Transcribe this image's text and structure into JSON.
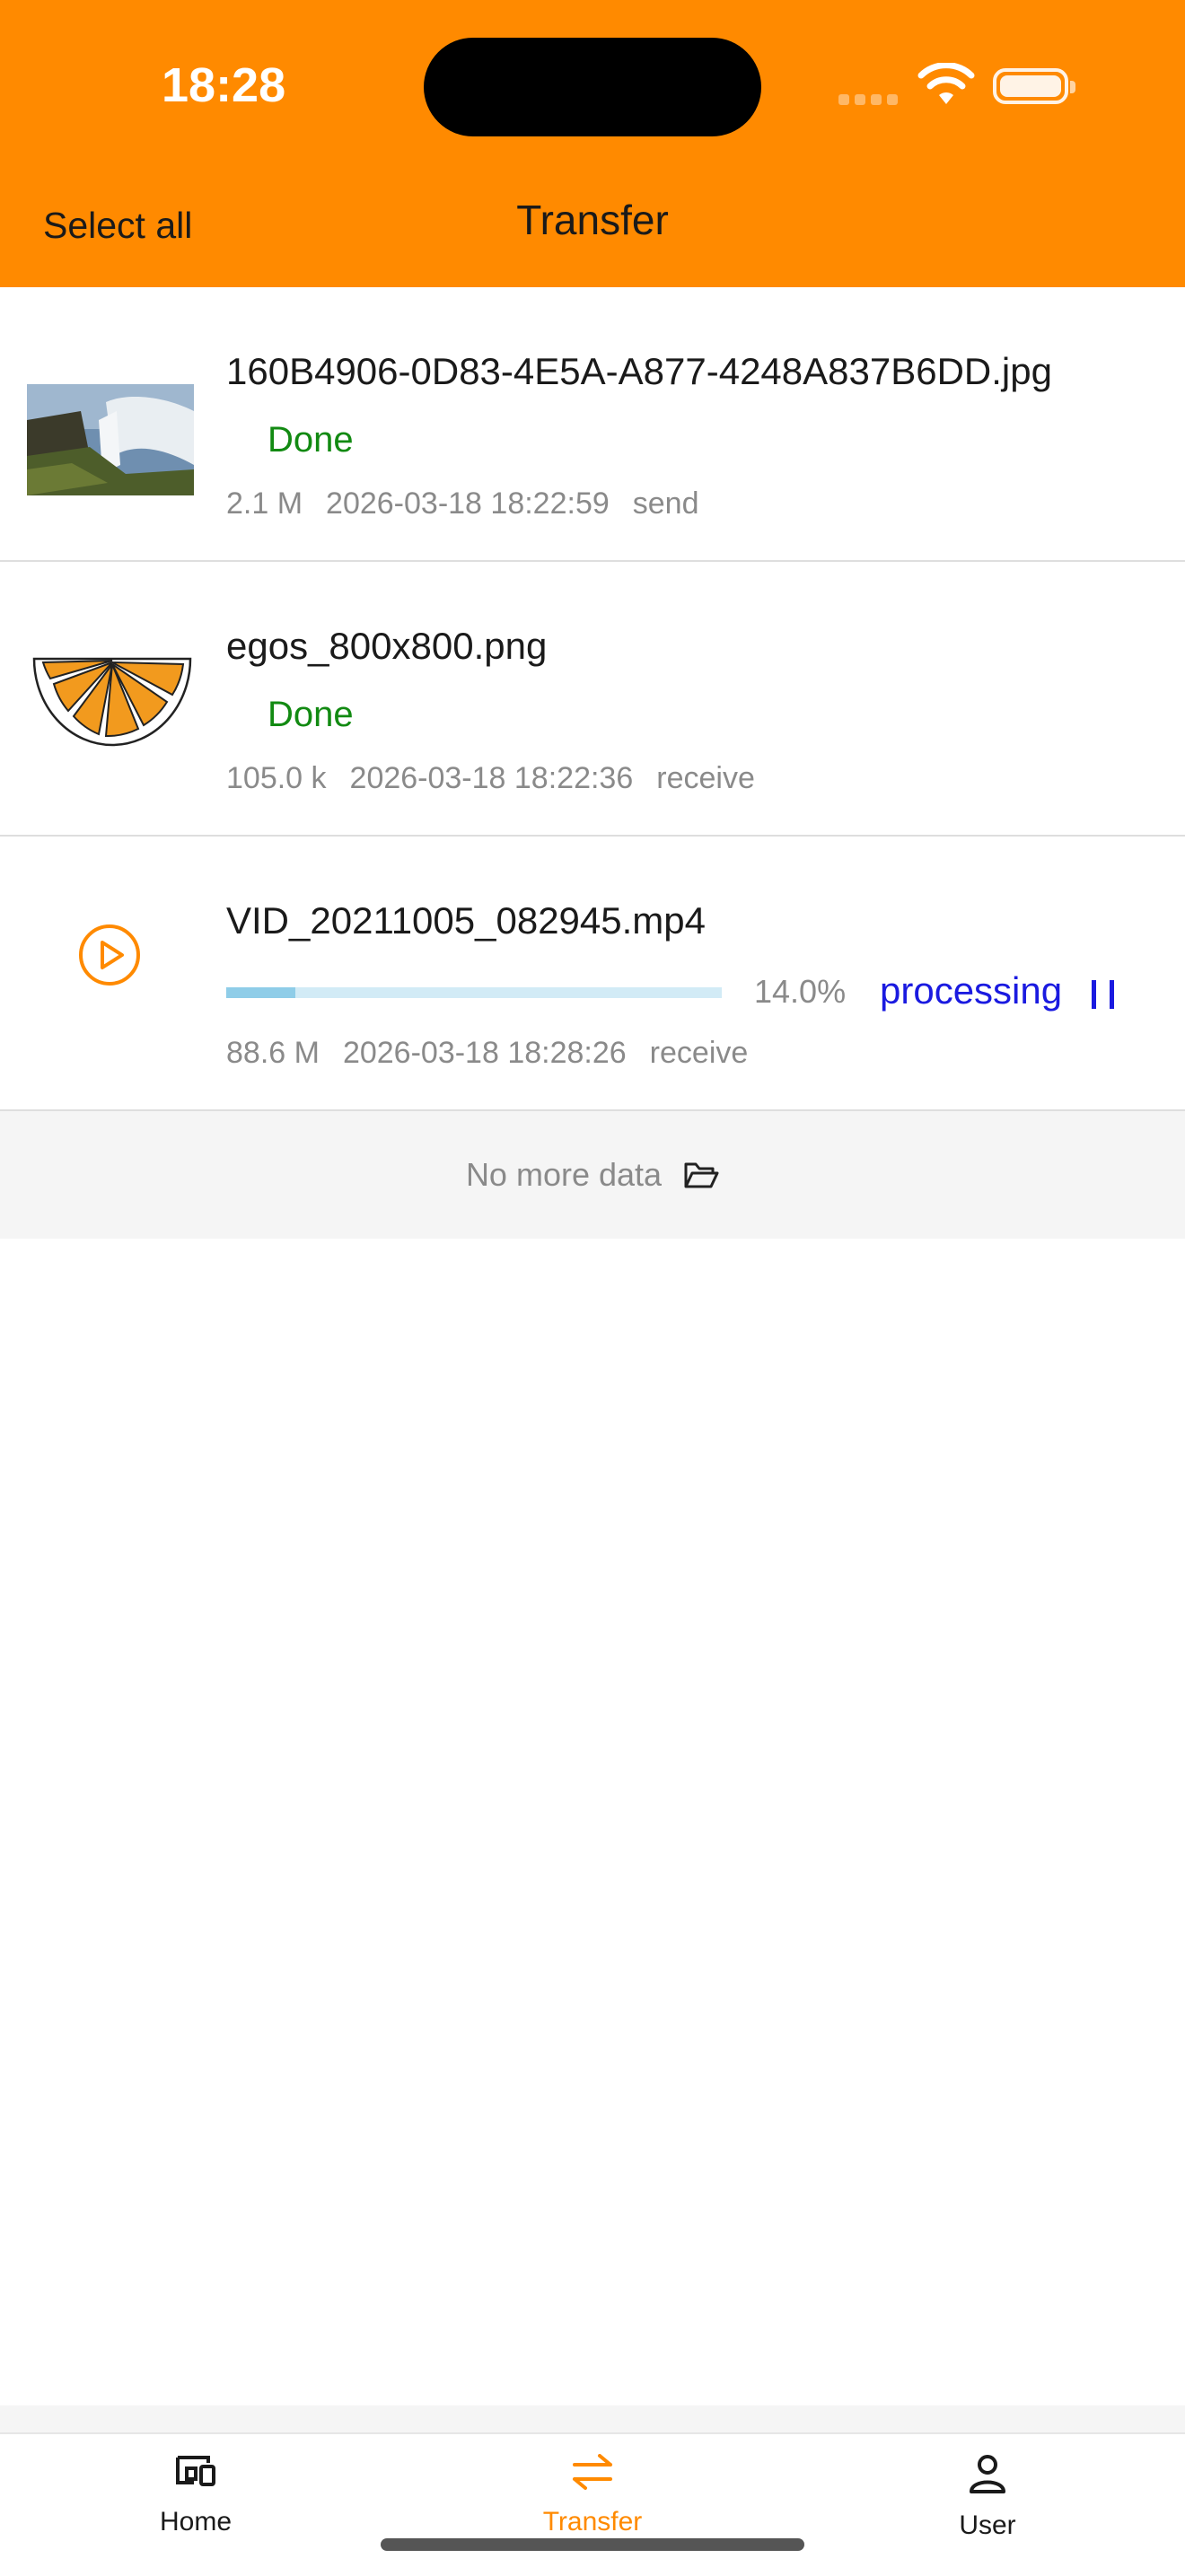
{
  "status_bar": {
    "time": "18:28"
  },
  "header": {
    "select_all": "Select all",
    "title": "Transfer"
  },
  "transfers": [
    {
      "name": "160B4906-0D83-4E5A-A877-4248A837B6DD.jpg",
      "status": "Done",
      "size": "2.1 M",
      "date": "2026-03-18 18:22:59",
      "direction": "send"
    },
    {
      "name": "egos_800x800.png",
      "status": "Done",
      "size": "105.0 k",
      "date": "2026-03-18 18:22:36",
      "direction": "receive"
    },
    {
      "name": "VID_20211005_082945.mp4",
      "progress_percent": 14.0,
      "progress_label": "14.0%",
      "status": "processing",
      "size": "88.6 M",
      "date": "2026-03-18 18:28:26",
      "direction": "receive"
    }
  ],
  "list_footer": "No more data",
  "tabs": {
    "home": "Home",
    "transfer": "Transfer",
    "user": "User"
  },
  "colors": {
    "brand": "#ff8a00",
    "done": "#128a12",
    "processing": "#1a1ae0"
  }
}
